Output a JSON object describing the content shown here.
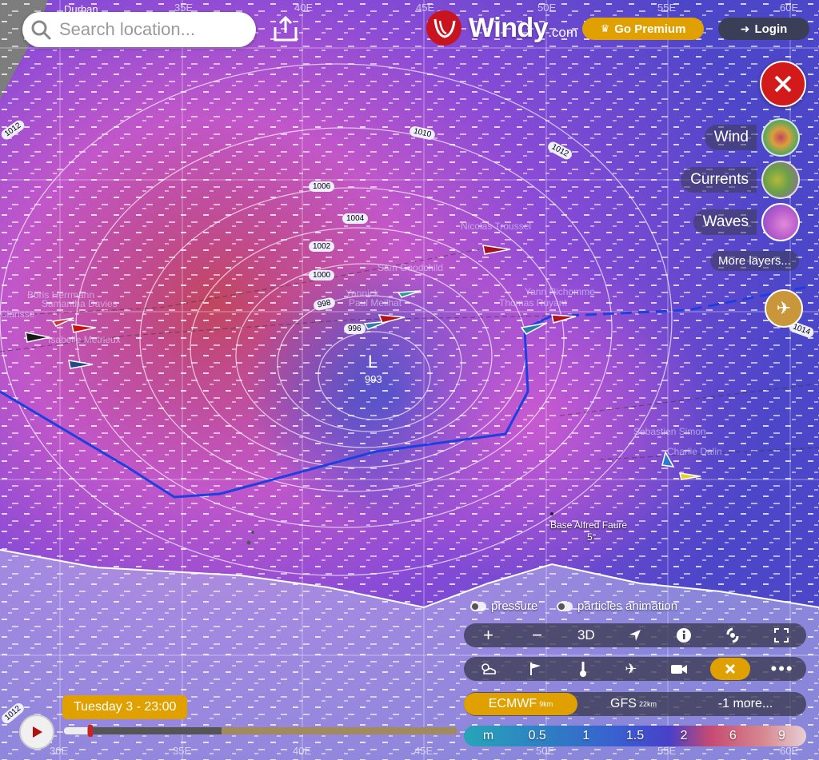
{
  "colors": {
    "premium": "#e0a100",
    "close_button": "#d31a1a",
    "route": "#1c3fe0",
    "timeline_label": "#e0a100"
  },
  "search": {
    "placeholder": "Search location...",
    "icon": "search-icon"
  },
  "header": {
    "share_icon": "upload-icon",
    "logo_brand": "Windy",
    "logo_suffix": ".com",
    "premium_label": "Go Premium",
    "login_label": "Login"
  },
  "close_icon": "close-icon",
  "layers": [
    {
      "label": "Wind",
      "icon": "wind-layer-icon"
    },
    {
      "label": "Currents",
      "icon": "currents-layer-icon"
    },
    {
      "label": "Waves",
      "icon": "waves-layer-icon"
    }
  ],
  "more_layers_label": "More layers...",
  "plane_icon": "plane-icon",
  "map": {
    "coastal_label": "Durban",
    "longitude_labels": [
      "35E",
      "40E",
      "45E",
      "50E",
      "55E",
      "60E"
    ],
    "bottom_longitude_labels": [
      "30E",
      "35E",
      "40E",
      "45E",
      "50E",
      "55E",
      "60E"
    ],
    "isobar_labels": [
      "1012",
      "1010",
      "1012",
      "1006",
      "1004",
      "1002",
      "1000",
      "998",
      "996",
      "1014",
      "1012"
    ],
    "low_symbol": "L",
    "low_value": "993",
    "station_name": "Base Alfred Faure",
    "station_temp": "5°",
    "sailors": [
      "Boris Herrmann",
      "Samantha Davies",
      "Clarisse",
      "Isabelle Metrieux",
      "Sam Goodchild",
      "Yannick",
      "Paul Meilhat",
      "Nicolas Troussel",
      "Thomas Ruyant",
      "Charlie Dalin",
      "Sebastien Simon",
      "Yann Richomme"
    ]
  },
  "toggles": {
    "pressure_label": "pressure",
    "particles_label": "particles animation"
  },
  "toolbar1": {
    "zoom_in": "+",
    "zoom_out": "−",
    "three_d": "3D",
    "locate_icon": "location-arrow-icon",
    "info_icon": "info-icon",
    "hurricane_icon": "hurricane-icon",
    "fullscreen_icon": "fullscreen-icon"
  },
  "toolbar2": {
    "icons": [
      "weather-icon",
      "flag-icon",
      "thermometer-icon",
      "plane-icon",
      "camera-icon",
      "close-icon",
      "more-icon"
    ]
  },
  "models": {
    "active": "ECMWF",
    "active_sub": "9km",
    "other": "GFS",
    "other_sub": "22km",
    "more": "-1 more..."
  },
  "timeline": {
    "label": "Tuesday 3 - 23:00",
    "play_icon": "play-icon"
  },
  "legend": {
    "unit": "m",
    "values": [
      "0.5",
      "1",
      "1.5",
      "2",
      "6",
      "9"
    ]
  }
}
